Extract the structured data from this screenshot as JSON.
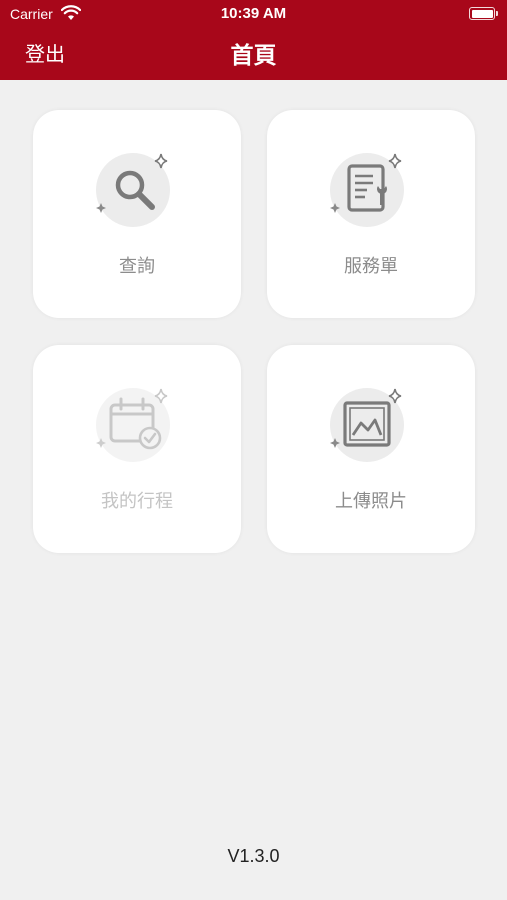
{
  "status_bar": {
    "carrier": "Carrier",
    "time": "10:39 AM"
  },
  "header": {
    "logout_label": "登出",
    "title": "首頁"
  },
  "menu": {
    "search": {
      "label": "查詢",
      "icon": "search-icon"
    },
    "service_order": {
      "label": "服務單",
      "icon": "service-order-icon"
    },
    "my_schedule": {
      "label": "我的行程",
      "icon": "calendar-check-icon"
    },
    "upload_photo": {
      "label": "上傳照片",
      "icon": "image-upload-icon"
    }
  },
  "footer": {
    "version": "V1.3.0"
  },
  "colors": {
    "header_bg": "#a8071a",
    "page_bg": "#f0f0f0",
    "card_bg": "#ffffff",
    "label_gray": "#8c8c8c",
    "disabled_gray": "#c4c4c4"
  }
}
